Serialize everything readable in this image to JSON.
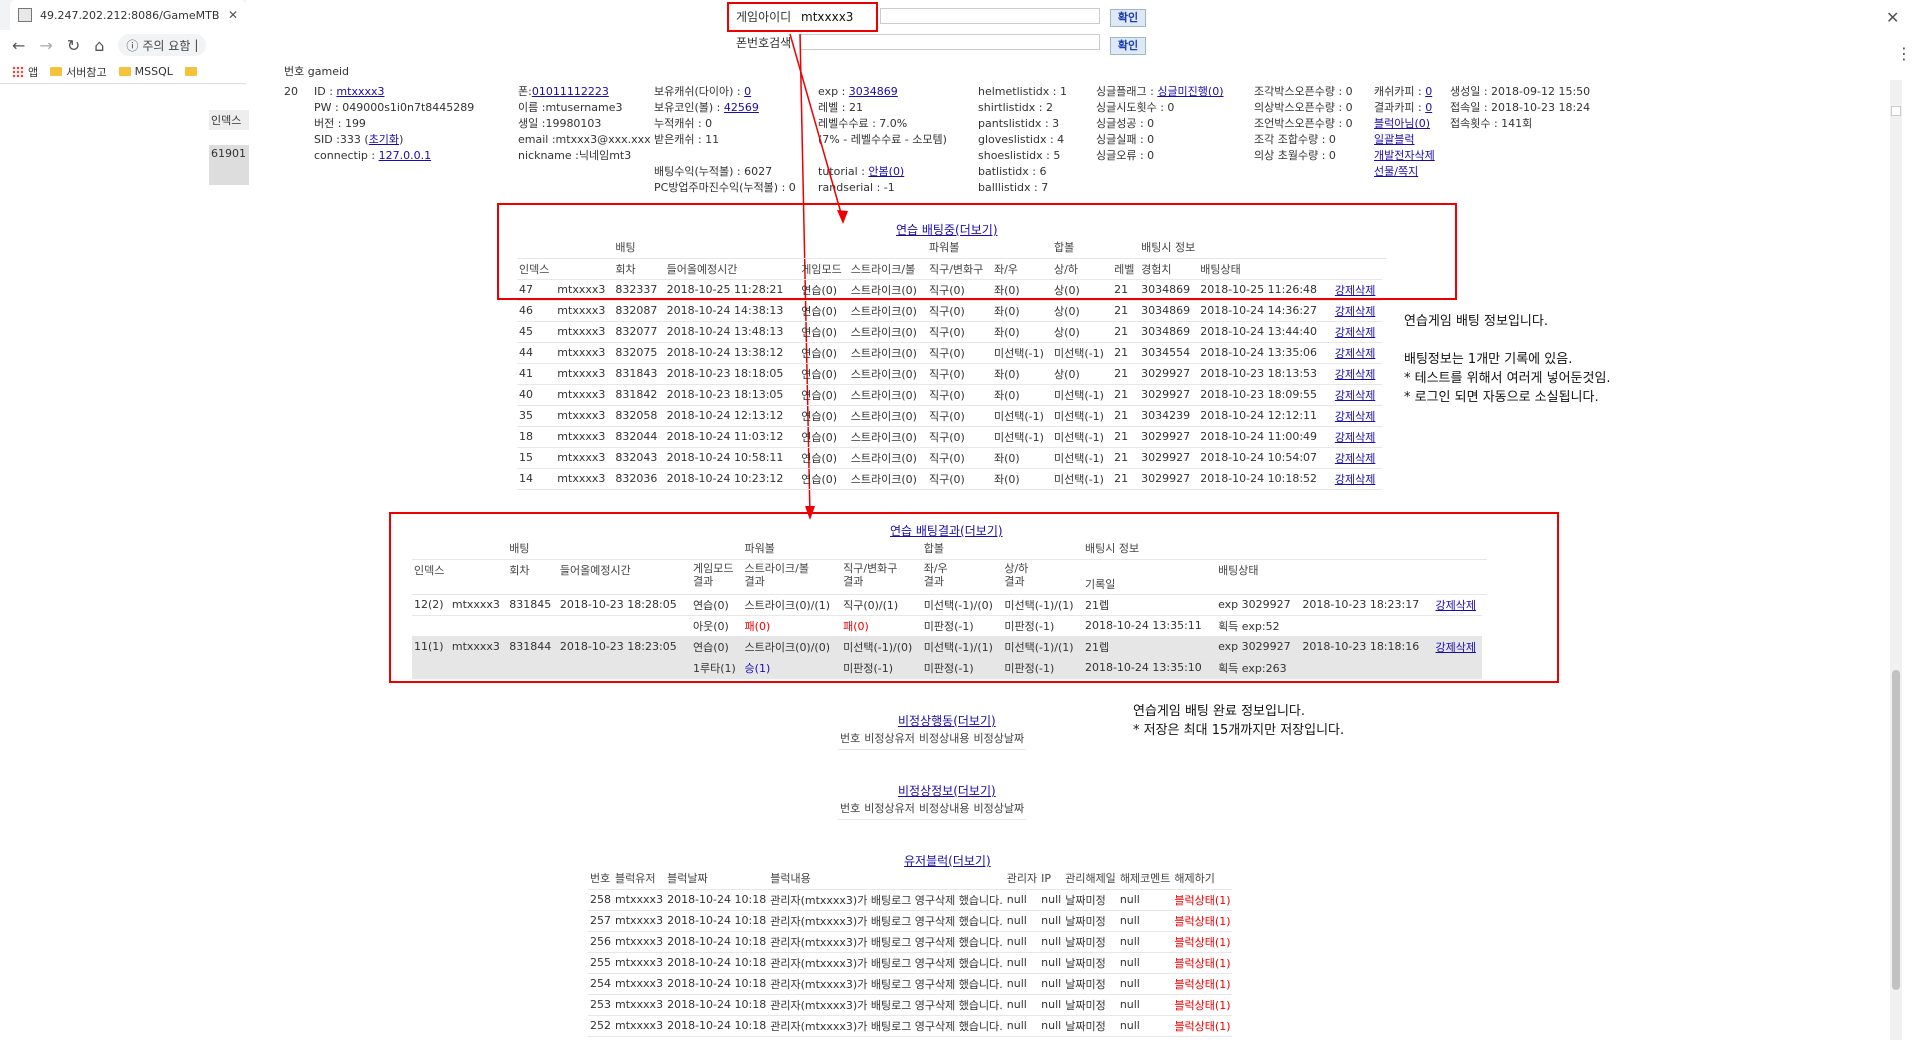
{
  "browser": {
    "tab_title": "49.247.202.212:8086/GameMTB",
    "address_security": "주의 요함",
    "bookmarks": [
      "앱",
      "서버참고",
      "MSSQL"
    ]
  },
  "search": {
    "game_id_label": "게임아이디",
    "game_id_value": "mtxxxx3",
    "phone_label": "폰번호검색",
    "confirm": "확인"
  },
  "left_panel": {
    "label1": "인덱스",
    "label2": "61901"
  },
  "user_info": {
    "hdr_no": "번호",
    "hdr_gameid": "gameid",
    "no": "20",
    "col1": [
      "ID : ",
      "PW : 049000s1i0n7t8445289",
      "버전 : 199",
      "SID :333 (",
      "connectip : "
    ],
    "id_link": "mtxxxx3",
    "sid_link": "초기화",
    "ip_link": "127.0.0.1",
    "col2": [
      "폰:",
      "이름 :mtusername3",
      "생일 :19980103",
      "email :mtxxx3@xxx.xxx",
      "nickname :닉네임mt3"
    ],
    "phone_link": "01011112223",
    "col3": [
      "보유캐쉬(다이아) : ",
      "보유코인(볼) : ",
      "누적캐쉬 : 0",
      "받은캐쉬 : 11",
      "",
      "배팅수익(누적볼) : 6027",
      "PC방업주마진수익(누적볼) : 0"
    ],
    "cash_link": "0",
    "coin_link": "42569",
    "col4": [
      "exp : ",
      "레벨 : 21",
      "레벨수수료 : 7.0%",
      "(7% - 레벨수수료 - 소모템)",
      "",
      "tutorial : ",
      "randserial : -1"
    ],
    "exp_link": "3034869",
    "tutorial_link": "안봄(0)",
    "col5": [
      "helmetlistidx : 1",
      "shirtlistidx : 2",
      "pantslistidx : 3",
      "gloveslistidx : 4",
      "shoeslistidx : 5",
      "batlistidx : 6",
      "balllistidx : 7"
    ],
    "col6": [
      "싱글플래그 : ",
      "싱글시도횟수 : 0",
      "싱글성공 : 0",
      "싱글실패 : 0",
      "싱글오류 : 0"
    ],
    "single_flag_link": "싱글미진행(0)",
    "col7": [
      "조각박스오픈수량 : 0",
      "의상박스오픈수량 : 0",
      "조언박스오픈수량 : 0",
      "조각 조합수량 : 0",
      "의상 초월수량 : 0"
    ],
    "col8": [
      "캐쉬카피 : ",
      "결과카피 : ",
      "블럭아님(0)",
      "일괄블럭",
      "개발전자삭제",
      "선물/쪽지"
    ],
    "cashcopy_link": "0",
    "resultcopy_link": "0",
    "col9": [
      "생성일 : 2018-09-12 15:50",
      "접속일 : 2018-10-23 18:24",
      "접속횟수 : 141회"
    ]
  },
  "betting": {
    "title": "연습 배팅중(더보기)",
    "group_headers": [
      "배팅",
      "파워볼",
      "합볼",
      "배팅시 정보"
    ],
    "headers": [
      "인덱스",
      "",
      "회차",
      "들어올예정시간",
      "게임모드",
      "스트라이크/볼",
      "직구/변화구",
      "좌/우",
      "상/하",
      "레벨",
      "경험치",
      "배팅상태",
      ""
    ],
    "rows": [
      [
        "47",
        "mtxxxx3",
        "832337",
        "2018-10-25 11:28:21",
        "연습(0)",
        "스트라이크(0)",
        "직구(0)",
        "좌(0)",
        "상(0)",
        "21",
        "3034869",
        "2018-10-25 11:26:48",
        "강제삭제"
      ],
      [
        "46",
        "mtxxxx3",
        "832087",
        "2018-10-24 14:38:13",
        "연습(0)",
        "스트라이크(0)",
        "직구(0)",
        "좌(0)",
        "상(0)",
        "21",
        "3034869",
        "2018-10-24 14:36:27",
        "강제삭제"
      ],
      [
        "45",
        "mtxxxx3",
        "832077",
        "2018-10-24 13:48:13",
        "연습(0)",
        "스트라이크(0)",
        "직구(0)",
        "좌(0)",
        "상(0)",
        "21",
        "3034869",
        "2018-10-24 13:44:40",
        "강제삭제"
      ],
      [
        "44",
        "mtxxxx3",
        "832075",
        "2018-10-24 13:38:12",
        "연습(0)",
        "스트라이크(0)",
        "직구(0)",
        "미선택(-1)",
        "미선택(-1)",
        "21",
        "3034554",
        "2018-10-24 13:35:06",
        "강제삭제"
      ],
      [
        "41",
        "mtxxxx3",
        "831843",
        "2018-10-23 18:18:05",
        "연습(0)",
        "스트라이크(0)",
        "직구(0)",
        "좌(0)",
        "상(0)",
        "21",
        "3029927",
        "2018-10-23 18:13:53",
        "강제삭제"
      ],
      [
        "40",
        "mtxxxx3",
        "831842",
        "2018-10-23 18:13:05",
        "연습(0)",
        "스트라이크(0)",
        "직구(0)",
        "좌(0)",
        "미선택(-1)",
        "21",
        "3029927",
        "2018-10-23 18:09:55",
        "강제삭제"
      ],
      [
        "35",
        "mtxxxx3",
        "832058",
        "2018-10-24 12:13:12",
        "연습(0)",
        "스트라이크(0)",
        "직구(0)",
        "미선택(-1)",
        "미선택(-1)",
        "21",
        "3034239",
        "2018-10-24 12:12:11",
        "강제삭제"
      ],
      [
        "18",
        "mtxxxx3",
        "832044",
        "2018-10-24 11:03:12",
        "연습(0)",
        "스트라이크(0)",
        "직구(0)",
        "미선택(-1)",
        "미선택(-1)",
        "21",
        "3029927",
        "2018-10-24 11:00:49",
        "강제삭제"
      ],
      [
        "15",
        "mtxxxx3",
        "832043",
        "2018-10-24 10:58:11",
        "연습(0)",
        "스트라이크(0)",
        "직구(0)",
        "좌(0)",
        "미선택(-1)",
        "21",
        "3029927",
        "2018-10-24 10:54:07",
        "강제삭제"
      ],
      [
        "14",
        "mtxxxx3",
        "832036",
        "2018-10-24 10:23:12",
        "연습(0)",
        "스트라이크(0)",
        "직구(0)",
        "좌(0)",
        "미선택(-1)",
        "21",
        "3029927",
        "2018-10-24 10:18:52",
        "강제삭제"
      ]
    ]
  },
  "note1": "연습게임 배팅 정보입니다.\n\n배팅정보는 1개만 기록에 있음.\n* 테스트를 위해서 여러게 넣어둔것임.\n* 로그인 되면 자동으로 소실됩니다.",
  "results": {
    "title": "연습 배팅결과(더보기)",
    "group_headers": [
      "배팅",
      "파워볼",
      "합볼",
      "배팅시 정보"
    ],
    "headers": [
      "인덱스",
      "회차",
      "들어올예정시간",
      "게임모드\n결과",
      "스트라이크/볼\n결과",
      "직구/변화구\n결과",
      "좌/우\n결과",
      "상/하\n결과",
      "기록일",
      "배팅상태"
    ],
    "rows": [
      {
        "a": [
          "12(2)",
          "mtxxxx3",
          "831845",
          "2018-10-23 18:28:05",
          "연습(0)",
          "스트라이크(0)/(1)",
          "직구(0)/(1)",
          "미선택(-1)/(0)",
          "미선택(-1)/(1)",
          "21렙",
          "exp 3029927",
          "2018-10-23 18:23:17",
          "강제삭제"
        ],
        "b": [
          "",
          "",
          "",
          "",
          "아웃(0)",
          "패(0)",
          "패(0)",
          "미판정(-1)",
          "미판정(-1)",
          "2018-10-24 13:35:11",
          "획득 exp:52",
          "",
          ""
        ]
      },
      {
        "a": [
          "11(1)",
          "mtxxxx3",
          "831844",
          "2018-10-23 18:23:05",
          "연습(0)",
          "스트라이크(0)/(0)",
          "미선택(-1)/(0)",
          "미선택(-1)/(1)",
          "미선택(-1)/(1)",
          "21렙",
          "exp 3029927",
          "2018-10-23 18:18:16",
          "강제삭제"
        ],
        "b": [
          "",
          "",
          "",
          "",
          "1루타(1)",
          "승(1)",
          "미판정(-1)",
          "미판정(-1)",
          "미판정(-1)",
          "2018-10-24 13:35:10",
          "획득 exp:263",
          "",
          ""
        ]
      }
    ]
  },
  "note2": "연습게임 배팅 완료 정보입니다.\n* 저장은 최대 15개까지만 저장입니다.",
  "abnormal_action": {
    "title": "비정상행동(더보기)",
    "headers": [
      "번호",
      "비정상유저",
      "비정상내용",
      "비정상날짜"
    ]
  },
  "abnormal_info": {
    "title": "비정상정보(더보기)",
    "headers": [
      "번호",
      "비정상유저",
      "비정상내용",
      "비정상날짜"
    ]
  },
  "user_block": {
    "title": "유저블럭(더보기)",
    "headers": [
      "번호",
      "블럭유저",
      "블럭날짜",
      "블럭내용",
      "관리자",
      "IP",
      "관리해제일",
      "해제코멘트",
      "해제하기"
    ],
    "rows": [
      [
        "258",
        "mtxxxx3",
        "2018-10-24 10:18",
        "관리자(mtxxxx3)가 배팅로그 영구삭제 했습니다.",
        "null",
        "null",
        "날짜미정",
        "null",
        "블럭상태(1)"
      ],
      [
        "257",
        "mtxxxx3",
        "2018-10-24 10:18",
        "관리자(mtxxxx3)가 배팅로그 영구삭제 했습니다.",
        "null",
        "null",
        "날짜미정",
        "null",
        "블럭상태(1)"
      ],
      [
        "256",
        "mtxxxx3",
        "2018-10-24 10:18",
        "관리자(mtxxxx3)가 배팅로그 영구삭제 했습니다.",
        "null",
        "null",
        "날짜미정",
        "null",
        "블럭상태(1)"
      ],
      [
        "255",
        "mtxxxx3",
        "2018-10-24 10:18",
        "관리자(mtxxxx3)가 배팅로그 영구삭제 했습니다.",
        "null",
        "null",
        "날짜미정",
        "null",
        "블럭상태(1)"
      ],
      [
        "254",
        "mtxxxx3",
        "2018-10-24 10:18",
        "관리자(mtxxxx3)가 배팅로그 영구삭제 했습니다.",
        "null",
        "null",
        "날짜미정",
        "null",
        "블럭상태(1)"
      ],
      [
        "253",
        "mtxxxx3",
        "2018-10-24 10:18",
        "관리자(mtxxxx3)가 배팅로그 영구삭제 했습니다.",
        "null",
        "null",
        "날짜미정",
        "null",
        "블럭상태(1)"
      ],
      [
        "252",
        "mtxxxx3",
        "2018-10-24 10:18",
        "관리자(mtxxxx3)가 배팅로그 영구삭제 했습니다.",
        "null",
        "null",
        "날짜미정",
        "null",
        "블럭상태(1)"
      ]
    ]
  }
}
